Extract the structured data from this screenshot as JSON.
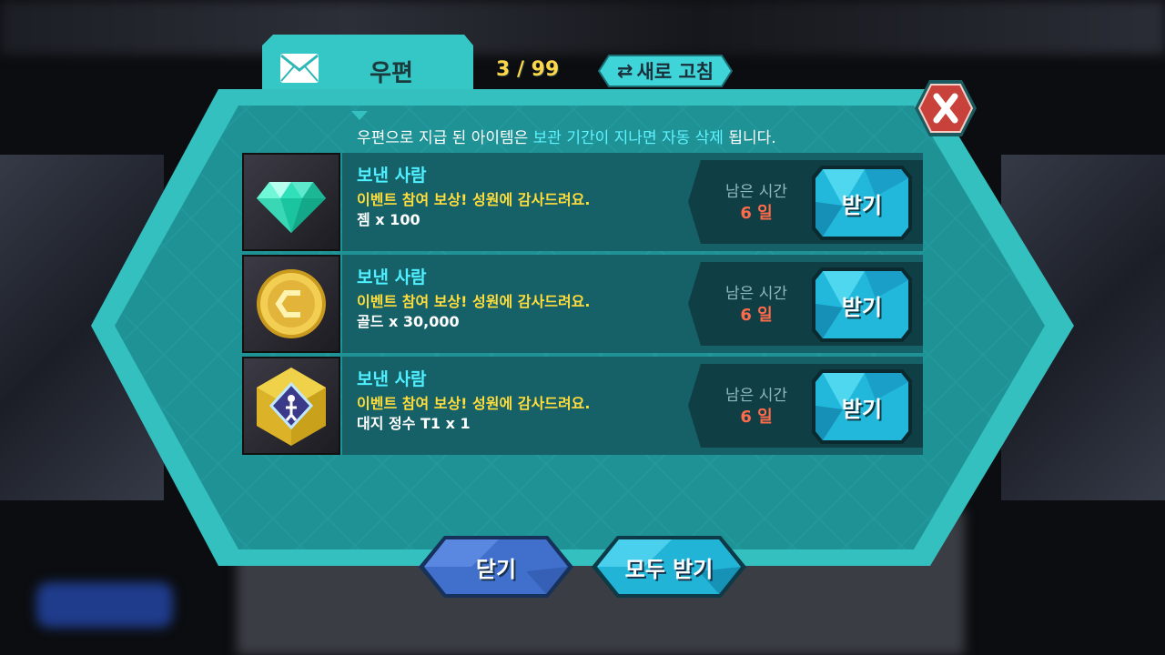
{
  "header": {
    "tab_title": "우편",
    "counter": "3 / 99",
    "refresh_label": "새로 고침"
  },
  "notice": {
    "prefix": "우편으로 지급 된 아이템은 ",
    "highlight": "보관 기간이 지나면 자동 삭제",
    "suffix": " 됩니다."
  },
  "mails": [
    {
      "sender_label": "보낸 사람",
      "message": "이벤트 참여 보상! 성원에 감사드려요.",
      "reward": "젬 x 100",
      "remaining_label": "남은 시간",
      "remaining_value": "6 일",
      "claim_label": "받기",
      "icon": "gem-icon"
    },
    {
      "sender_label": "보낸 사람",
      "message": "이벤트 참여 보상! 성원에 감사드려요.",
      "reward": "골드 x 30,000",
      "remaining_label": "남은 시간",
      "remaining_value": "6 일",
      "claim_label": "받기",
      "icon": "gold-coin-icon"
    },
    {
      "sender_label": "보낸 사람",
      "message": "이벤트 참여 보상! 성원에 감사드려요.",
      "reward": "대지 정수 T1 x 1",
      "remaining_label": "남은 시간",
      "remaining_value": "6 일",
      "claim_label": "받기",
      "icon": "earth-essence-icon"
    }
  ],
  "footer": {
    "close_label": "닫기",
    "claim_all_label": "모두 받기"
  },
  "colors": {
    "panel_teal": "#2cb0b0",
    "panel_inner": "#1d8a8e",
    "accent_cyan": "#4ff0ff",
    "message_yellow": "#ffdd3c",
    "time_red": "#ff6b4a",
    "close_red": "#c8413a",
    "button_blue": "#3f6cc8"
  }
}
